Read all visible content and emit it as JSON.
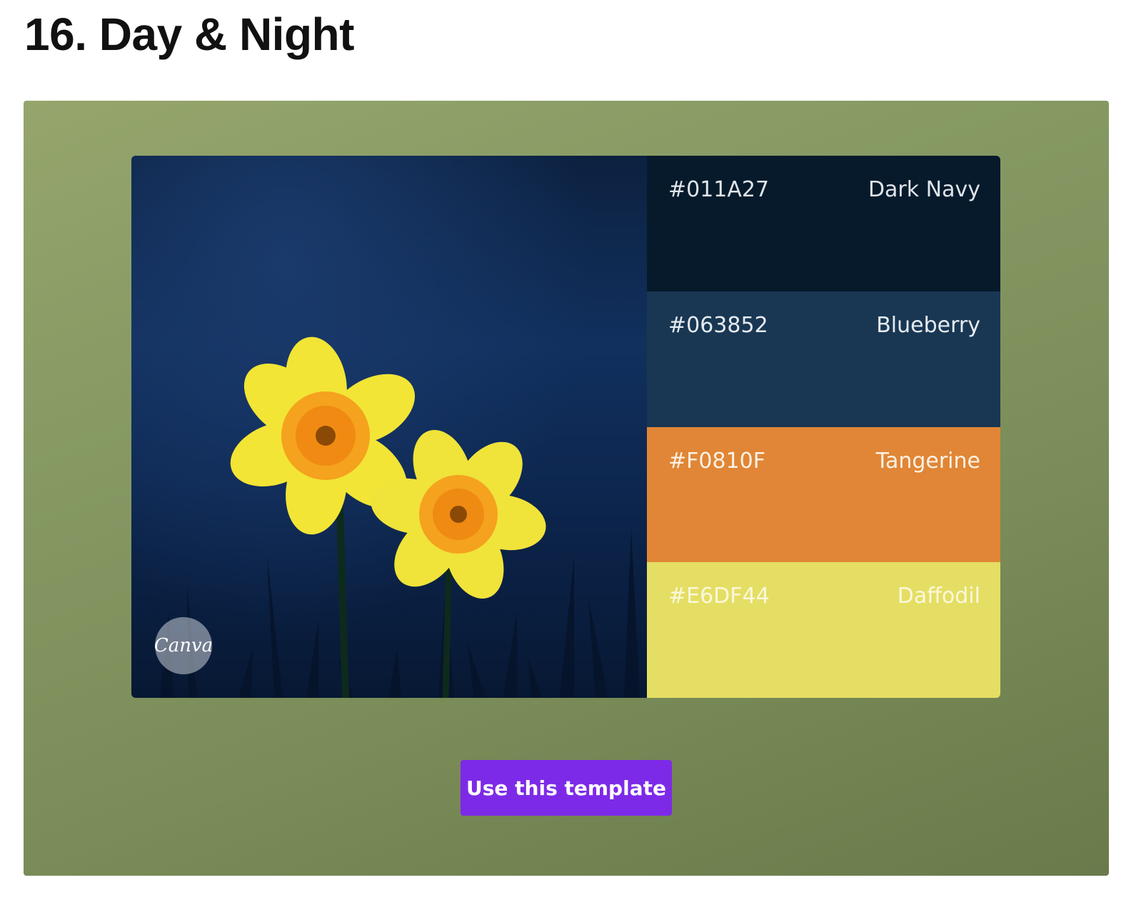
{
  "page": {
    "title": "16. Day & Night"
  },
  "photo": {
    "subject": "Two yellow daffodils against a dark blue background",
    "logo_text": "Canva"
  },
  "palette": {
    "swatches": [
      {
        "hex": "#011A27",
        "name": "Dark Navy",
        "bg": "#061a2b",
        "text_color": "#dfe4ea"
      },
      {
        "hex": "#063852",
        "name": "Blueberry",
        "bg": "#193753",
        "text_color": "#e6ebf0"
      },
      {
        "hex": "#F0810F",
        "name": "Tangerine",
        "bg": "#e08636",
        "text_color": "#fdf1e4"
      },
      {
        "hex": "#E6DF44",
        "name": "Daffodil",
        "bg": "#e5de64",
        "text_color": "#faf8dc"
      }
    ]
  },
  "actions": {
    "use_template_label": "Use this template"
  },
  "colors": {
    "button_bg": "#7d2ae8",
    "card_bg": "#869864"
  }
}
